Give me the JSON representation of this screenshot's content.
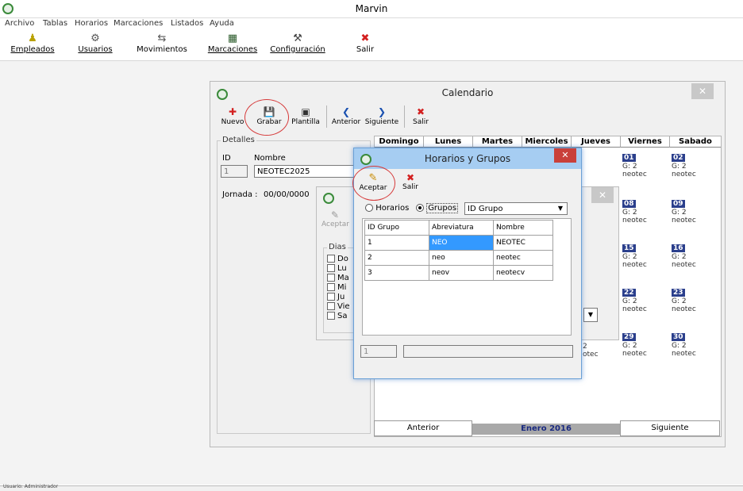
{
  "app": {
    "title": "Marvin"
  },
  "menu": [
    "Archivo",
    "Tablas",
    "Horarios",
    "Marcaciones",
    "Listados",
    "Ayuda"
  ],
  "toolbar": {
    "empleados": "Empleados",
    "usuarios": "Usuarios",
    "movimientos": "Movimientos",
    "marcaciones": "Marcaciones",
    "configuracion": "Configuración",
    "salir": "Salir"
  },
  "calendario": {
    "title": "Calendario",
    "tools": {
      "nuevo": "Nuevo",
      "grabar": "Grabar",
      "plantilla": "Plantilla",
      "anterior": "Anterior",
      "siguiente": "Siguiente",
      "salir": "Salir"
    },
    "detalles_label": "Detalles",
    "id_label": "ID",
    "nombre_label": "Nombre",
    "id_value": "1",
    "nombre_value": "NEOTEC2025",
    "jornada_label": "Jornada :",
    "jornada_value": "00/00/0000",
    "days": [
      "Domingo",
      "Lunes",
      "Martes",
      "Miercoles",
      "Jueves",
      "Viernes",
      "Sabado"
    ],
    "cells": [
      {
        "day": "01",
        "g": "G: 2",
        "n": "neotec"
      },
      {
        "day": "02",
        "g": "G: 2",
        "n": "neotec"
      },
      {
        "day": "08",
        "g": "G: 2",
        "n": "neotec"
      },
      {
        "day": "09",
        "g": "G: 2",
        "n": "neotec"
      },
      {
        "day": "15",
        "g": "G: 2",
        "n": "neotec"
      },
      {
        "day": "16",
        "g": "G: 2",
        "n": "neotec"
      },
      {
        "day": "22",
        "g": "G: 2",
        "n": "neotec"
      },
      {
        "day": "23",
        "g": "G: 2",
        "n": "neotec"
      },
      {
        "day": "29",
        "g": "G: 2",
        "n": "neotec"
      },
      {
        "day": "30",
        "g": "G: 2",
        "n": "neotec"
      }
    ],
    "partial_cell": {
      "g": "2",
      "n": "otec"
    },
    "nav_prev": "Anterior",
    "month": "Enero 2016",
    "nav_next": "Siguiente"
  },
  "sub": {
    "aceptar": "Aceptar",
    "dias_label": "Dias",
    "dias": [
      "Do",
      "Lu",
      "Ma",
      "Mi",
      "Ju",
      "Vie",
      "Sa"
    ]
  },
  "hg": {
    "title": "Horarios y Grupos",
    "close": "✕",
    "aceptar": "Aceptar",
    "salir": "Salir",
    "radio_horarios": "Horarios",
    "radio_grupos": "Grupos",
    "combo_value": "ID Grupo",
    "columns": [
      "ID Grupo",
      "Abreviatura",
      "Nombre"
    ],
    "rows": [
      [
        "1",
        "NEO",
        "NEOTEC"
      ],
      [
        "2",
        "neo",
        "neotec"
      ],
      [
        "3",
        "neov",
        "neotecv"
      ]
    ],
    "footer_value": "1"
  },
  "status": {
    "text": "Usuario: Administrador"
  }
}
